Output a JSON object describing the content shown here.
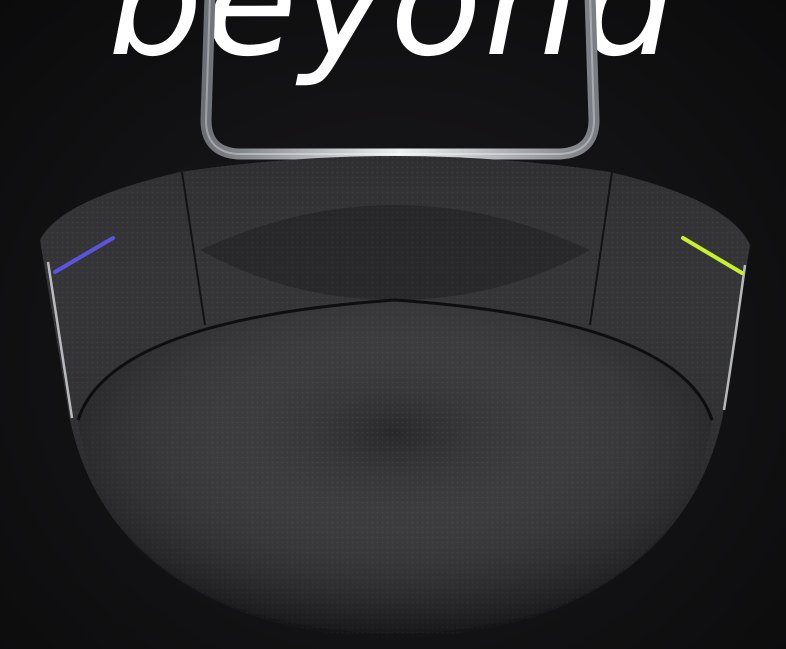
{
  "image": {
    "headline_text": "beyond",
    "subject": "speakerphone-device",
    "colors": {
      "background": "#111012",
      "body": "#1b1a1c",
      "mesh": "#222124",
      "chrome": "#cfd2d6",
      "left_led": "#5a55e0",
      "right_led": "#c9f02a"
    }
  }
}
